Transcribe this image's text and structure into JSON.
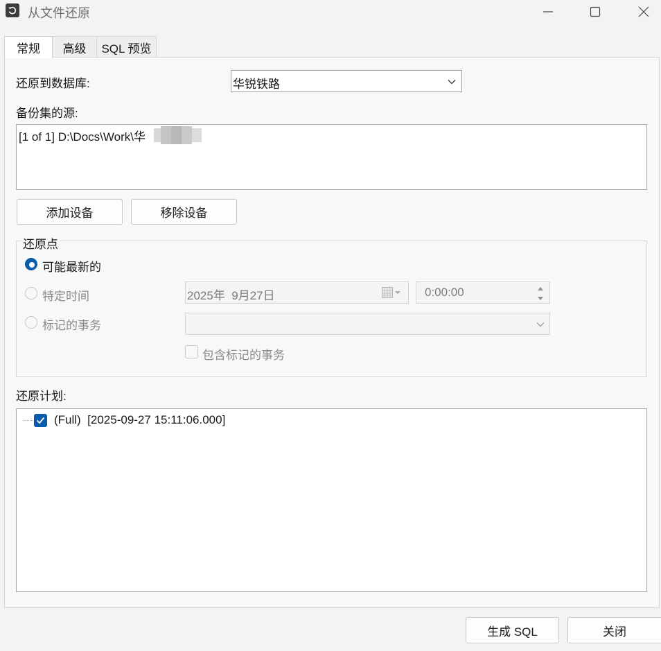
{
  "window": {
    "title": "从文件还原"
  },
  "tabs": [
    {
      "label": "常规"
    },
    {
      "label": "高级"
    },
    {
      "label": "SQL 预览"
    }
  ],
  "restore_to": {
    "label": "还原到数据库:",
    "value": "华锐铁路"
  },
  "backup_source": {
    "label": "备份集的源:",
    "items": [
      "[1 of 1] D:\\Docs\\Work\\华        bak"
    ]
  },
  "buttons": {
    "add_device": "添加设备",
    "remove_device": "移除设备",
    "generate_sql": "生成 SQL",
    "close": "关闭"
  },
  "restore_point": {
    "title": "还原点",
    "latest": "可能最新的",
    "specific_time": "特定时间",
    "date_value": "2025年  9月27日",
    "time_value": "0:00:00",
    "marked_transaction": "标记的事务",
    "marked_value": "",
    "include_marked": "包含标记的事务"
  },
  "plan": {
    "label": "还原计划:",
    "items": [
      {
        "text": "(Full)  [2025-09-27 15:11:06.000]",
        "checked": true
      }
    ]
  },
  "colors": {
    "accent": "#0b5cad",
    "background": "#f3f3f3",
    "disabled_text": "#8a8a8a"
  }
}
